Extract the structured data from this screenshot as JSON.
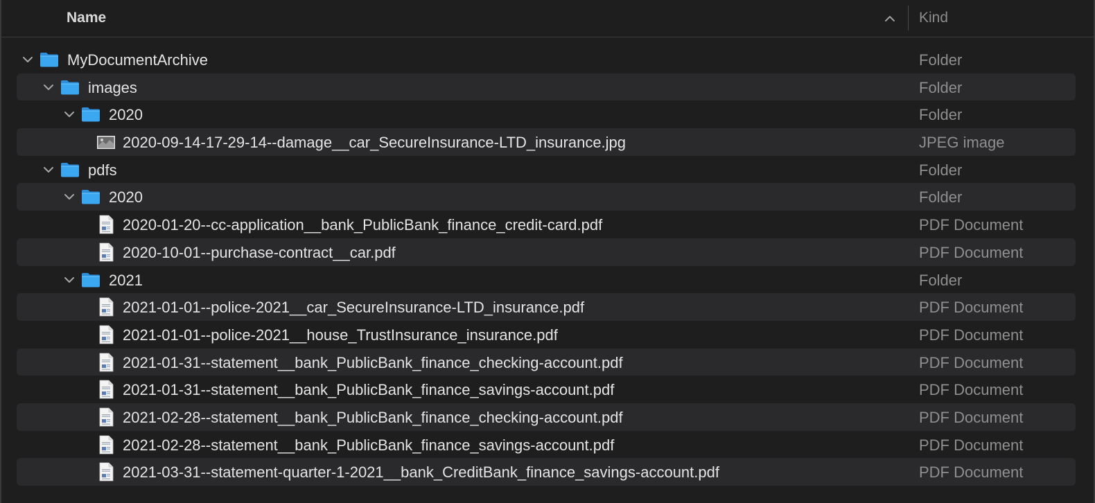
{
  "header": {
    "name_label": "Name",
    "kind_label": "Kind",
    "sort_icon": "chevron-up-icon"
  },
  "rows": [
    {
      "name": "MyDocumentArchive",
      "kind": "Folder",
      "type": "folder",
      "level": 0,
      "expanded": true
    },
    {
      "name": "images",
      "kind": "Folder",
      "type": "folder",
      "level": 1,
      "expanded": true
    },
    {
      "name": "2020",
      "kind": "Folder",
      "type": "folder",
      "level": 2,
      "expanded": true
    },
    {
      "name": "2020-09-14-17-29-14--damage__car_SecureInsurance-LTD_insurance.jpg",
      "kind": "JPEG image",
      "type": "image",
      "level": 3
    },
    {
      "name": "pdfs",
      "kind": "Folder",
      "type": "folder",
      "level": 1,
      "expanded": true
    },
    {
      "name": "2020",
      "kind": "Folder",
      "type": "folder",
      "level": 2,
      "expanded": true
    },
    {
      "name": "2020-01-20--cc-application__bank_PublicBank_finance_credit-card.pdf",
      "kind": "PDF Document",
      "type": "pdf",
      "level": 3
    },
    {
      "name": "2020-10-01--purchase-contract__car.pdf",
      "kind": "PDF Document",
      "type": "pdf",
      "level": 3
    },
    {
      "name": "2021",
      "kind": "Folder",
      "type": "folder",
      "level": 2,
      "expanded": true
    },
    {
      "name": "2021-01-01--police-2021__car_SecureInsurance-LTD_insurance.pdf",
      "kind": "PDF Document",
      "type": "pdf",
      "level": 3
    },
    {
      "name": "2021-01-01--police-2021__house_TrustInsurance_insurance.pdf",
      "kind": "PDF Document",
      "type": "pdf",
      "level": 3
    },
    {
      "name": "2021-01-31--statement__bank_PublicBank_finance_checking-account.pdf",
      "kind": "PDF Document",
      "type": "pdf",
      "level": 3
    },
    {
      "name": "2021-01-31--statement__bank_PublicBank_finance_savings-account.pdf",
      "kind": "PDF Document",
      "type": "pdf",
      "level": 3
    },
    {
      "name": "2021-02-28--statement__bank_PublicBank_finance_checking-account.pdf",
      "kind": "PDF Document",
      "type": "pdf",
      "level": 3
    },
    {
      "name": "2021-02-28--statement__bank_PublicBank_finance_savings-account.pdf",
      "kind": "PDF Document",
      "type": "pdf",
      "level": 3
    },
    {
      "name": "2021-03-31--statement-quarter-1-2021__bank_CreditBank_finance_savings-account.pdf",
      "kind": "PDF Document",
      "type": "pdf",
      "level": 3
    }
  ],
  "colors": {
    "background": "#1e1e1e",
    "alt_row": "#2a2a2c",
    "folder": "#3ba7f0",
    "text": "#e4e4e4",
    "kind_text": "#8f8f8f"
  }
}
